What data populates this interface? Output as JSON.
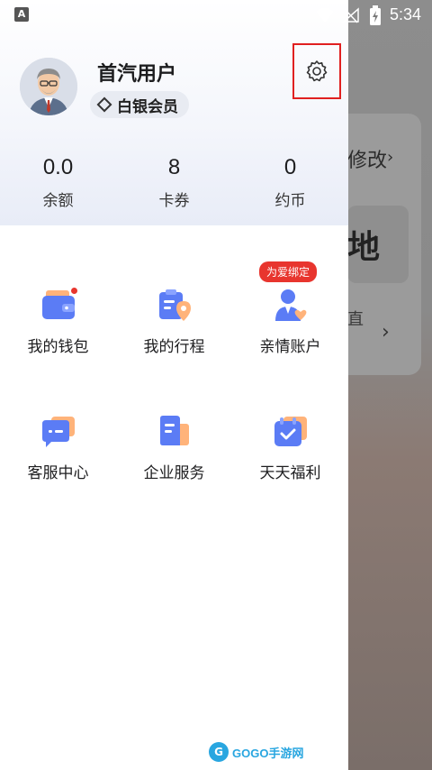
{
  "status_bar": {
    "time": "5:34",
    "app_icon_letter": "A"
  },
  "background": {
    "modify_text": "修改",
    "big_char": "地",
    "small_text": "直"
  },
  "profile": {
    "username": "首汽用户",
    "member_level": "白银会员"
  },
  "stats": [
    {
      "value": "0.0",
      "label": "余额"
    },
    {
      "value": "8",
      "label": "卡券"
    },
    {
      "value": "0",
      "label": "约币"
    }
  ],
  "grid": [
    [
      {
        "label": "我的钱包",
        "icon": "wallet-icon",
        "has_dot": true
      },
      {
        "label": "我的行程",
        "icon": "trip-icon"
      },
      {
        "label": "亲情账户",
        "icon": "family-account-icon",
        "tag": "为爱绑定"
      }
    ],
    [
      {
        "label": "客服中心",
        "icon": "customer-service-icon"
      },
      {
        "label": "企业服务",
        "icon": "enterprise-icon"
      },
      {
        "label": "天天福利",
        "icon": "daily-benefit-icon"
      }
    ]
  ],
  "watermark": {
    "badge": "G",
    "text": "GOGO手游网"
  },
  "colors": {
    "accent_red": "#e8352e",
    "icon_blue": "#5b7cf5",
    "icon_orange": "#ffb37a",
    "watermark_blue": "#29a6e0"
  }
}
